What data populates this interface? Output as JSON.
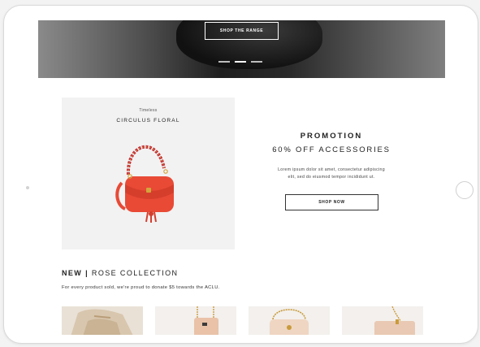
{
  "hero": {
    "cta_label": "SHOP THE RANGE",
    "carousel_active_index": 1
  },
  "product": {
    "tag": "Timeless",
    "name": "CIRCULUS FLORAL",
    "bag_color": "#e84a36"
  },
  "promotion": {
    "title": "PROMOTION",
    "subtitle": "60% OFF ACCESSORIES",
    "text_line1": "Lorem ipsum dolor sit amet, consectetur adipiscing",
    "text_line2": "elit, sed do eiusmod tempor incididunt ut.",
    "button_label": "SHOP NOW"
  },
  "collection": {
    "new_label": "NEW |",
    "name": "ROSE COLLECTION",
    "subtitle": "For every product sold, we're proud to donate $5 towards the ACLU."
  },
  "colors": {
    "accent": "#e84a36",
    "text": "#222222",
    "panel": "#f2f2f2"
  },
  "icons": [
    "home-button",
    "camera-dot"
  ]
}
